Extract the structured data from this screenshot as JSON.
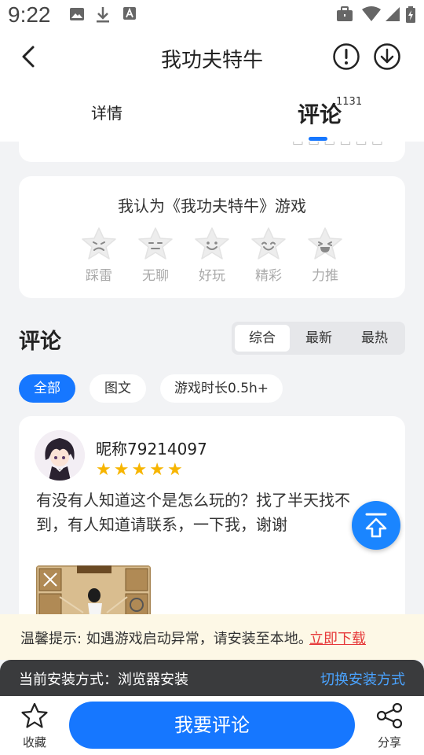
{
  "status_bar": {
    "time": "9:22"
  },
  "header": {
    "title": "我功夫特牛"
  },
  "tabs": [
    {
      "label": "详情",
      "active": false
    },
    {
      "label": "评论",
      "active": true,
      "badge": "1131"
    }
  ],
  "rating": {
    "prompt": "我认为《我功夫特牛》游戏",
    "options": [
      {
        "label": "踩雷",
        "icon": "sad-star-icon"
      },
      {
        "label": "无聊",
        "icon": "bored-star-icon"
      },
      {
        "label": "好玩",
        "icon": "smile-star-icon"
      },
      {
        "label": "精彩",
        "icon": "happy-star-icon"
      },
      {
        "label": "力推",
        "icon": "excited-star-icon"
      }
    ]
  },
  "comments_section": {
    "title": "评论",
    "sort_options": [
      {
        "label": "综合",
        "active": true
      },
      {
        "label": "最新",
        "active": false
      },
      {
        "label": "最热",
        "active": false
      }
    ],
    "filters": [
      {
        "label": "全部",
        "active": true
      },
      {
        "label": "图文",
        "active": false
      },
      {
        "label": "游戏时长0.5h+",
        "active": false
      }
    ]
  },
  "comment": {
    "nickname": "昵称79214097",
    "stars": 5,
    "text": "有没有人知道这个是怎么玩的？找了半天找不到，有人知道请联系，一下我，谢谢"
  },
  "notice": {
    "text": "温馨提示: 如遇游戏启动异常，请安装至本地。",
    "link": "立即下载"
  },
  "install": {
    "text": "当前安装方式：浏览器安装",
    "switch_label": "切换安装方式"
  },
  "bottom_bar": {
    "favorite_label": "收藏",
    "comment_button": "我要评论",
    "share_label": "分享"
  },
  "colors": {
    "accent": "#1677ff",
    "star": "#f7b500",
    "link_red": "#e63939",
    "notice_bg": "#fdf8e6",
    "install_bg": "#3a3b3d"
  }
}
